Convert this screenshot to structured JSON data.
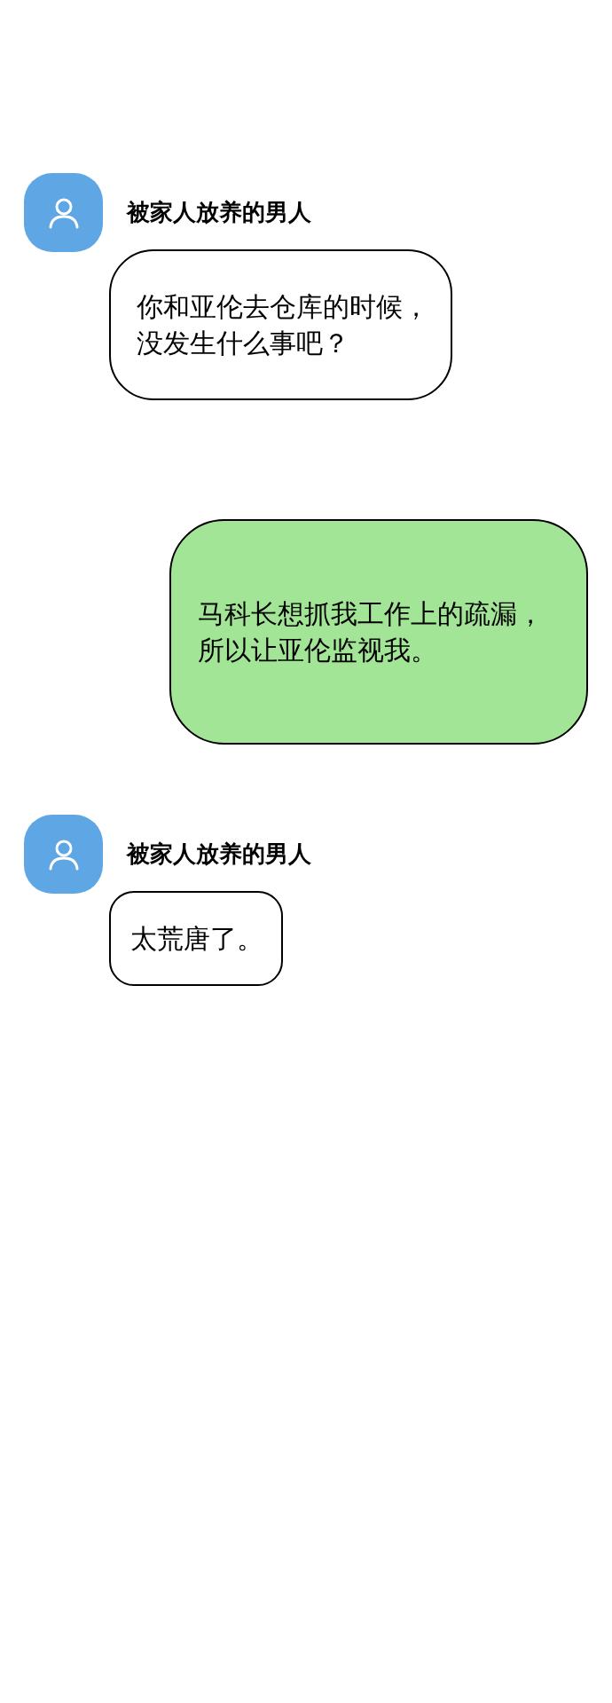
{
  "messages": [
    {
      "kind": "incoming",
      "sender": "被家人放养的男人",
      "lines": [
        "你和亚伦去仓库的时候，",
        "没发生什么事吧？"
      ]
    },
    {
      "kind": "outgoing",
      "lines": [
        "马科长想抓我工作上的疏漏，",
        "所以让亚伦监视我。"
      ]
    },
    {
      "kind": "incoming",
      "sender": "被家人放养的男人",
      "lines": [
        "太荒唐了。"
      ]
    }
  ]
}
